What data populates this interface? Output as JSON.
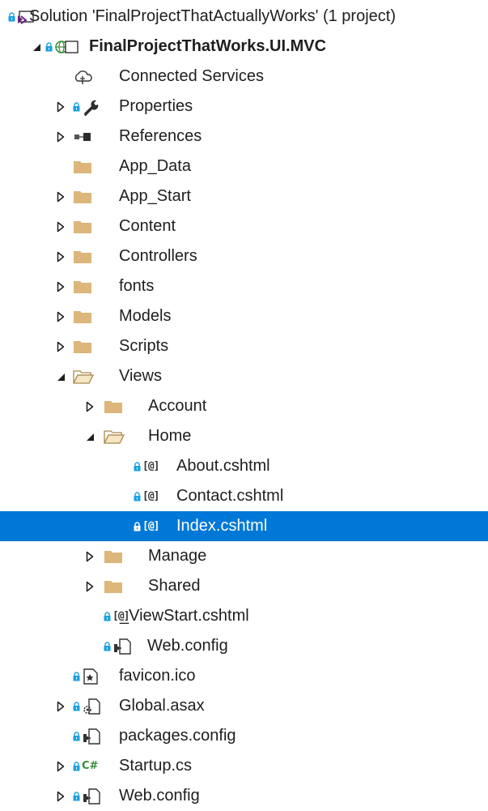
{
  "explorer": {
    "items": [
      {
        "label": "Solution 'FinalProjectThatActuallyWorks' (1 project)",
        "icon": "solution-icon",
        "lock": true,
        "expander": "none",
        "depth": 0
      },
      {
        "label": "FinalProjectThatWorks.UI.MVC",
        "icon": "web-project-icon",
        "lock": true,
        "expander": "expanded",
        "depth": 1,
        "bold": true
      },
      {
        "label": "Connected Services",
        "icon": "connected-services-icon",
        "lock": false,
        "expander": "none",
        "depth": 2
      },
      {
        "label": "Properties",
        "icon": "wrench-icon",
        "lock": true,
        "expander": "collapsed",
        "depth": 2
      },
      {
        "label": "References",
        "icon": "references-icon",
        "lock": false,
        "expander": "collapsed",
        "depth": 2
      },
      {
        "label": "App_Data",
        "icon": "folder-icon",
        "lock": false,
        "expander": "none",
        "depth": 2
      },
      {
        "label": "App_Start",
        "icon": "folder-icon",
        "lock": false,
        "expander": "collapsed",
        "depth": 2
      },
      {
        "label": "Content",
        "icon": "folder-icon",
        "lock": false,
        "expander": "collapsed",
        "depth": 2
      },
      {
        "label": "Controllers",
        "icon": "folder-icon",
        "lock": false,
        "expander": "collapsed",
        "depth": 2
      },
      {
        "label": "fonts",
        "icon": "folder-icon",
        "lock": false,
        "expander": "collapsed",
        "depth": 2
      },
      {
        "label": "Models",
        "icon": "folder-icon",
        "lock": false,
        "expander": "collapsed",
        "depth": 2
      },
      {
        "label": "Scripts",
        "icon": "folder-icon",
        "lock": false,
        "expander": "collapsed",
        "depth": 2
      },
      {
        "label": "Views",
        "icon": "folder-open-icon",
        "lock": false,
        "expander": "expanded",
        "depth": 2
      },
      {
        "label": "Account",
        "icon": "folder-icon",
        "lock": false,
        "expander": "collapsed",
        "depth": 3
      },
      {
        "label": "Home",
        "icon": "folder-open-icon",
        "lock": false,
        "expander": "expanded",
        "depth": 3
      },
      {
        "label": "About.cshtml",
        "icon": "cshtml-icon",
        "lock": true,
        "expander": "none",
        "depth": 4
      },
      {
        "label": "Contact.cshtml",
        "icon": "cshtml-icon",
        "lock": true,
        "expander": "none",
        "depth": 4
      },
      {
        "label": "Index.cshtml",
        "icon": "cshtml-icon",
        "lock": true,
        "expander": "none",
        "depth": 4,
        "selected": true
      },
      {
        "label": "Manage",
        "icon": "folder-icon",
        "lock": false,
        "expander": "collapsed",
        "depth": 3
      },
      {
        "label": "Shared",
        "icon": "folder-icon",
        "lock": false,
        "expander": "collapsed",
        "depth": 3
      },
      {
        "label": "_ViewStart.cshtml",
        "icon": "cshtml-icon",
        "lock": true,
        "expander": "none",
        "depth": 3
      },
      {
        "label": "Web.config",
        "icon": "config-icon",
        "lock": true,
        "expander": "none",
        "depth": 3
      },
      {
        "label": "favicon.ico",
        "icon": "image-file-icon",
        "lock": true,
        "expander": "none",
        "depth": 2
      },
      {
        "label": "Global.asax",
        "icon": "global-asax-icon",
        "lock": true,
        "expander": "collapsed",
        "depth": 2
      },
      {
        "label": "packages.config",
        "icon": "config-icon",
        "lock": true,
        "expander": "none",
        "depth": 2
      },
      {
        "label": "Startup.cs",
        "icon": "csharp-icon",
        "lock": true,
        "expander": "collapsed",
        "depth": 2
      },
      {
        "label": "Web.config",
        "icon": "config-icon",
        "lock": true,
        "expander": "collapsed",
        "depth": 2
      }
    ],
    "glyphs": {
      "cshtml": "[@]",
      "csharp": "C#"
    },
    "colors": {
      "selection": "#0078d7",
      "folder": "#dcb67a",
      "lock": "#1ba1e2"
    }
  }
}
